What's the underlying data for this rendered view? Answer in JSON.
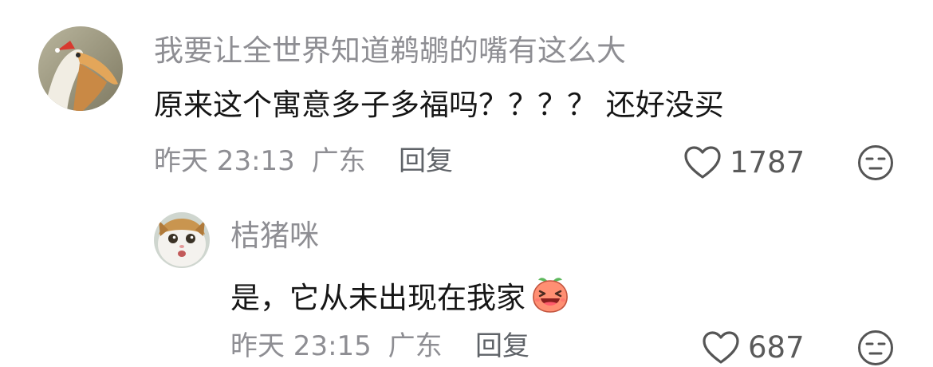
{
  "comments": [
    {
      "username": "我要让全世界知道鹈鹕的嘴有这么大",
      "text": "原来这个寓意多子多福吗？？？？ 还好没买",
      "time": "昨天 23:13",
      "location": "广东",
      "reply_label": "回复",
      "likes": "1787",
      "avatar_icon": "pelican-avatar",
      "dislike_icon": "neutral-face-icon"
    },
    {
      "username": "桔猪咪",
      "text": "是，它从未出现在我家",
      "emoji_icon": "laughing-peach-emoji",
      "time": "昨天 23:15",
      "location": "广东",
      "reply_label": "回复",
      "likes": "687",
      "avatar_icon": "cat-avatar",
      "dislike_icon": "neutral-face-icon"
    }
  ],
  "colors": {
    "meta_text": "#8e8e93",
    "body_text": "#161616",
    "icon_stroke": "#555555"
  }
}
